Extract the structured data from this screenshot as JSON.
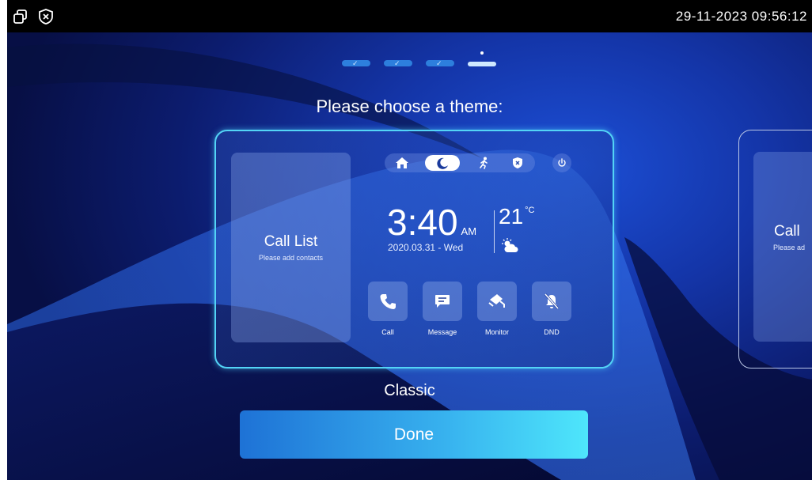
{
  "status_bar": {
    "datetime": "29-11-2023 09:56:12",
    "icons": [
      "window-restore-icon",
      "shield-x-icon"
    ]
  },
  "wizard": {
    "total_steps": 4,
    "completed_steps": 3,
    "prompt": "Please choose a theme:"
  },
  "theme_preview": {
    "call_list": {
      "title": "Call List",
      "subtitle": "Please add contacts"
    },
    "modes": [
      "home-icon",
      "night-moon-icon",
      "away-running-icon",
      "armed-shield-icon"
    ],
    "active_mode": "night-moon-icon",
    "clock": {
      "time": "3:40",
      "ampm": "AM",
      "date": "2020.03.31 - Wed"
    },
    "temperature": {
      "value": "21",
      "unit": "°C"
    },
    "weather_icon": "partly-cloudy-icon",
    "quick_actions": [
      {
        "label": "Call",
        "icon": "phone-icon"
      },
      {
        "label": "Message",
        "icon": "message-icon"
      },
      {
        "label": "Monitor",
        "icon": "camera-icon"
      },
      {
        "label": "DND",
        "icon": "bell-off-icon"
      }
    ]
  },
  "next_theme_preview": {
    "call_list": {
      "title": "Call",
      "subtitle": "Please ad"
    }
  },
  "theme_name": "Classic",
  "done_label": "Done",
  "colors": {
    "accent": "#53d4f6",
    "button_start": "#1e72d6",
    "button_end": "#4ee6fb",
    "background": "#0c1c6e"
  }
}
